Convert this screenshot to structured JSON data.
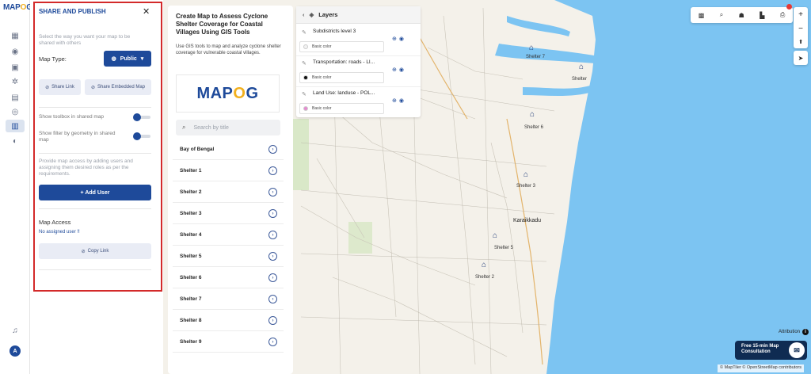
{
  "brand": {
    "logo_a": "MAP",
    "logo_b": "O",
    "logo_c": "G"
  },
  "share_panel": {
    "title": "SHARE AND PUBLISH",
    "intro": "Select the way you want your map to be shared with others",
    "map_type_label": "Map Type:",
    "map_type_value": "Public",
    "share_link": "Share Link",
    "share_embedded": "Share Embedded Map",
    "toggle_toolbox": "Show toolbox in shared map",
    "toggle_filter": "Show filter by geometry in shared map",
    "toggle_toolbox_on": true,
    "toggle_filter_on": true,
    "access_help": "Provide map access by adding users and assigning them desired roles as per the requirements.",
    "add_user": "+ Add User",
    "map_access_title": "Map Access",
    "no_user": "No assigned user !!",
    "copy_link": "Copy Link"
  },
  "project": {
    "title": "Create Map to Assess Cyclone Shelter Coverage for Coastal Villages Using GIS Tools",
    "description": "Use GIS tools to map and analyze cyclone shelter coverage for vulnerable coastal villages.",
    "logo_a": "MAP",
    "logo_b": "O",
    "logo_c": "G",
    "search_placeholder": "Search by title",
    "items": [
      "Bay of Bengal",
      "Shelter 1",
      "Shelter 2",
      "Shelter 3",
      "Shelter 4",
      "Shelter 5",
      "Shelter 6",
      "Shelter 7",
      "Shelter 8",
      "Shelter 9"
    ]
  },
  "layers": {
    "title": "Layers",
    "items": [
      {
        "name": "Subdistricts level 3",
        "color_label": "Basic color",
        "color": "#f2f2f2"
      },
      {
        "name": "Transportation: roads - LI...",
        "color_label": "Basic color",
        "color": "#111111"
      },
      {
        "name": "Land Use: landuse - POL...",
        "color_label": "Basic color",
        "color": "#e58bd0"
      }
    ]
  },
  "map": {
    "labels": [
      "Shelter 7",
      "Shelter",
      "Shelter 6",
      "Shelter 3",
      "Karaikkadu",
      "Shelter 5",
      "Shelter 2"
    ],
    "attribution": "Attribution",
    "consult_line1": "Free 15-min Map",
    "consult_line2": "Consultation",
    "copyright": "© MapTiler © OpenStreetMap contributors"
  },
  "colors": {
    "brand": "#1e4a9a",
    "accent": "#f2b01e",
    "sea": "#7cc4f2",
    "highlight": "#d32a2a"
  }
}
